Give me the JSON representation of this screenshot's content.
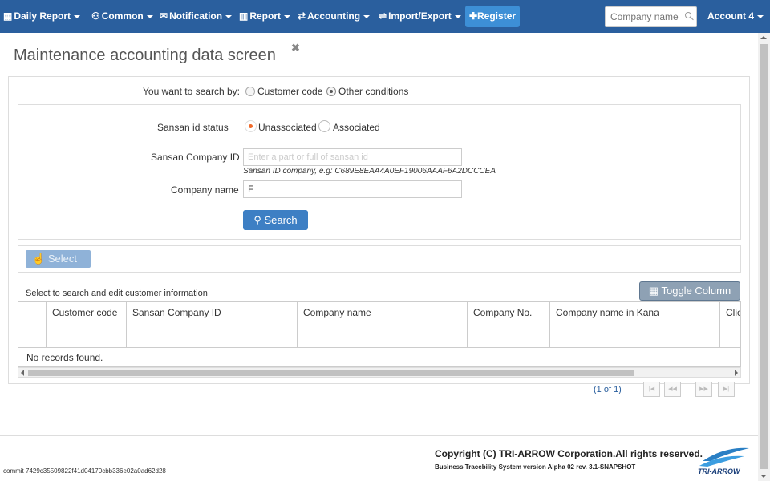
{
  "nav": {
    "items": [
      {
        "label": "Daily Report",
        "icon": "calendar-icon"
      },
      {
        "label": "Common",
        "icon": "users-icon"
      },
      {
        "label": "Notification",
        "icon": "envelope-icon"
      },
      {
        "label": "Report",
        "icon": "bar-chart-icon"
      },
      {
        "label": "Accounting",
        "icon": "exchange-icon"
      },
      {
        "label": "Import/Export",
        "icon": "transfer-icon"
      }
    ],
    "register_label": "Register",
    "search_placeholder": "Company name",
    "account_label": "Account 4"
  },
  "page": {
    "title": "Maintenance accounting data screen"
  },
  "search_by": {
    "label": "You want to search by:",
    "options": [
      "Customer code",
      "Other conditions"
    ],
    "selected": "Other conditions"
  },
  "form": {
    "sansan_status_label": "Sansan id status",
    "status_options": [
      "Unassociated",
      "Associated"
    ],
    "status_selected": "Unassociated",
    "sansan_company_id_label": "Sansan Company ID",
    "sansan_company_id_placeholder": "Enter a part or full of sansan id",
    "sansan_company_id_value": "",
    "hint": "Sansan ID company, e.g: C689E8EAA4A0EF19006AAAF6A2DCCCEA",
    "company_name_label": "Company name",
    "company_name_value": "F",
    "search_button": "Search"
  },
  "results": {
    "select_button": "Select",
    "subtitle": "Select to search and edit customer information",
    "toggle_column_button": "Toggle Column",
    "columns": [
      "",
      "Customer code",
      "Sansan Company ID",
      "Company name",
      "Company No.",
      "Company name in Kana",
      "Clie"
    ],
    "empty_message": "No records found.",
    "pager_text": "(1 of 1)"
  },
  "footer": {
    "copyright": "Copyright (C) TRI-ARROW Corporation.All rights reserved.",
    "version": "Business Tracebility System version Alpha 02 rev. 3.1-SNAPSHOT",
    "commit": "commit 7429c35509822f41d04170cbb336e02a0ad62d28",
    "logo_text": "TRI-ARROW"
  },
  "colors": {
    "navbar": "#2a5f9e",
    "primary_button": "#3d7fc4",
    "radio_selected": "#f06a2a"
  }
}
